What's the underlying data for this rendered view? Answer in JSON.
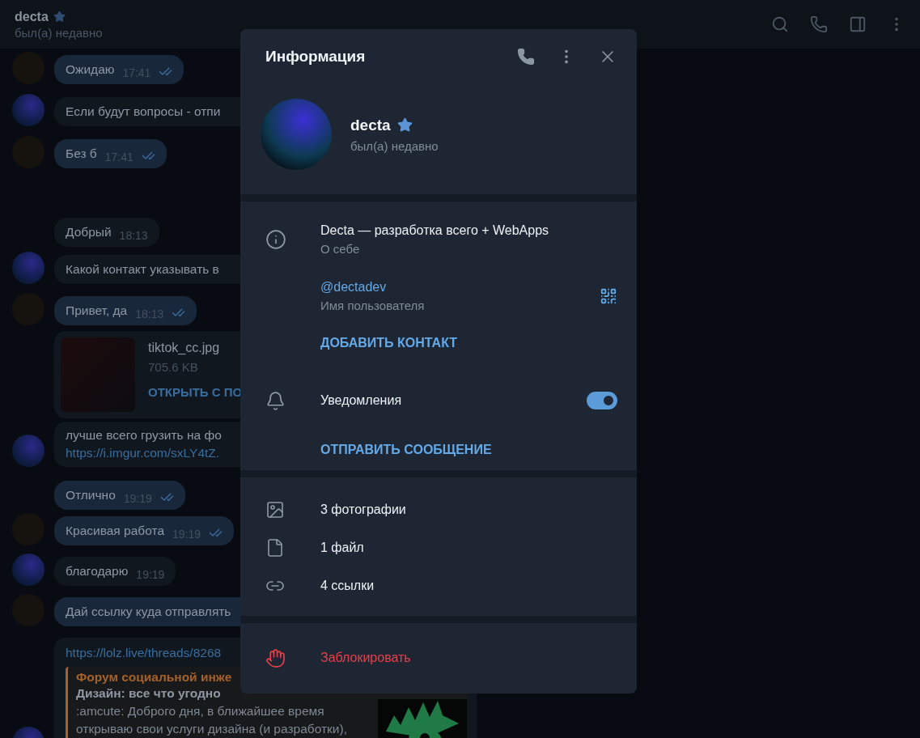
{
  "header": {
    "title": "decta",
    "status": "был(а) недавно"
  },
  "messages": [
    {
      "kind": "text",
      "outgoing": true,
      "avatar": {
        "kind": "person"
      },
      "text": "Ожидаю",
      "time": "17:41",
      "read": true
    },
    {
      "kind": "text",
      "outgoing": false,
      "avatar": {
        "kind": "logo"
      },
      "text": "Если будут вопросы - отпи",
      "read": false
    },
    {
      "kind": "text",
      "outgoing": true,
      "avatar": {
        "kind": "person"
      },
      "text": "Без б",
      "time": "17:41",
      "read": true
    },
    {
      "kind": "text",
      "outgoing": false,
      "text": "Добрый",
      "time": "18:13",
      "read": false
    },
    {
      "kind": "text",
      "outgoing": false,
      "avatar": {
        "kind": "logo"
      },
      "text": "Какой контакт указывать в",
      "read": false
    },
    {
      "kind": "text",
      "outgoing": true,
      "avatar": {
        "kind": "person"
      },
      "text": "Привет, да",
      "time": "18:13",
      "read": true
    },
    {
      "kind": "file",
      "name": "tiktok_cc.jpg",
      "size": "705.6 KB",
      "action": "ОТКРЫТЬ С ПО"
    },
    {
      "kind": "link_text",
      "avatar": {
        "kind": "logo"
      },
      "text": "лучше всего грузить на фо",
      "link": "https://i.imgur.com/sxLY4tZ."
    },
    {
      "kind": "text",
      "outgoing": true,
      "text": "Отлично",
      "time": "19:19",
      "read": true
    },
    {
      "kind": "text",
      "outgoing": true,
      "avatar": {
        "kind": "person"
      },
      "text": "Красивая работа",
      "time": "19:19",
      "read": true
    },
    {
      "kind": "text",
      "outgoing": false,
      "avatar": {
        "kind": "logo"
      },
      "text": "благодарю",
      "time": "19:19",
      "read": false
    },
    {
      "kind": "text",
      "outgoing": true,
      "avatar": {
        "kind": "person"
      },
      "text": "Дай ссылку куда отправлять",
      "read": false
    },
    {
      "kind": "preview",
      "avatar": {
        "kind": "logo"
      },
      "link": "https://lolz.live/threads/8268",
      "site": "Форум социальной инже",
      "title": "Дизайн: все что угодно",
      "description": ":amcute: Доброго дня, в ближайшее время открываю свои услуги дизайна (и разработки),"
    }
  ],
  "info_panel": {
    "title": "Информация",
    "profile": {
      "name": "decta",
      "status": "был(а) недавно"
    },
    "details": [
      {
        "kind": "about",
        "value": "Decta — разработка всего + WebApps",
        "label": "О себе"
      },
      {
        "kind": "username",
        "value": "@dectadev",
        "label": "Имя пользователя"
      }
    ],
    "add_contact": "ДОБАВИТЬ КОНТАКТ",
    "notifications": {
      "label": "Уведомления",
      "on": true
    },
    "send_message": "ОТПРАВИТЬ СООБЩЕНИЕ",
    "media": [
      {
        "kind": "photos",
        "label": "3 фотографии"
      },
      {
        "kind": "files",
        "label": "1 файл"
      },
      {
        "kind": "links",
        "label": "4 ссылки"
      }
    ],
    "block": "Заблокировать"
  }
}
